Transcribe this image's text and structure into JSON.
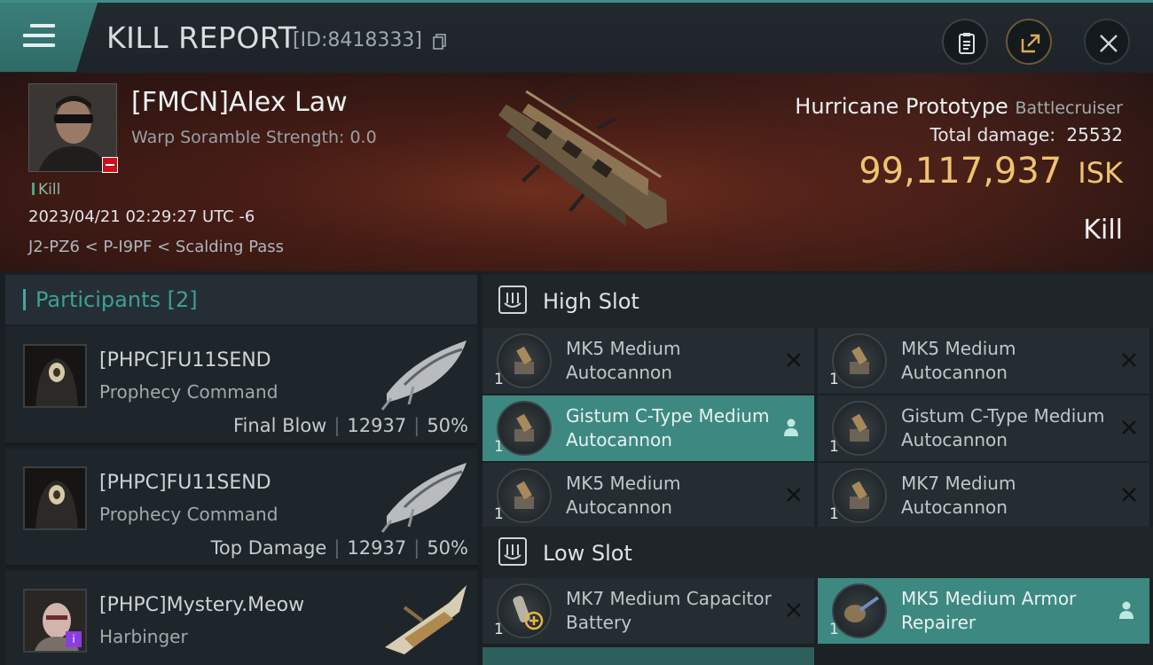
{
  "header": {
    "title": "KILL REPORT",
    "report_id": "[ID:8418333]",
    "icons": [
      "menu-icon",
      "copy-icon",
      "clipboard-icon",
      "share-icon",
      "close-icon"
    ]
  },
  "victim": {
    "name": "[FMCN]Alex Law",
    "scramble": "Warp Soramble Strength: 0.0",
    "kill_tag": "Kill",
    "datetime": "2023/04/21 02:29:27 UTC -6",
    "location": "J2-PZ6 < P-I9PF < Scalding Pass",
    "ship_name": "Hurricane Prototype",
    "ship_class": "Battlecruiser",
    "total_damage_label": "Total damage:",
    "total_damage": "25532",
    "isk_value": "99,117,937",
    "isk_unit": "ISK",
    "result": "Kill"
  },
  "participants": {
    "title": "Participants [2]",
    "rows": [
      {
        "name": "[PHPC]FU11SEND",
        "ship": "Prophecy Command",
        "role": "Final Blow",
        "damage": "12937",
        "percent": "50%"
      },
      {
        "name": "[PHPC]FU11SEND",
        "ship": "Prophecy Command",
        "role": "Top Damage",
        "damage": "12937",
        "percent": "50%"
      },
      {
        "name": "[PHPC]Mystery.Meow",
        "ship": "Harbinger",
        "badge": "i"
      }
    ]
  },
  "slots": {
    "high_title": "High Slot",
    "low_title": "Low Slot",
    "high": [
      {
        "qty": "1",
        "name": "MK5 Medium Autocannon",
        "highlight": false
      },
      {
        "qty": "1",
        "name": "MK5 Medium Autocannon",
        "highlight": false
      },
      {
        "qty": "1",
        "name": "Gistum C-Type Medium Autocannon",
        "highlight": true
      },
      {
        "qty": "1",
        "name": "Gistum C-Type Medium Autocannon",
        "highlight": false
      },
      {
        "qty": "1",
        "name": "MK5 Medium Autocannon",
        "highlight": false
      },
      {
        "qty": "1",
        "name": "MK7 Medium Autocannon",
        "highlight": false
      }
    ],
    "low": [
      {
        "qty": "1",
        "name": "MK7 Medium Capacitor Battery",
        "highlight": false
      },
      {
        "qty": "1",
        "name": "MK5 Medium Armor Repairer",
        "highlight": true
      }
    ]
  },
  "colors": {
    "accent": "#3f8e86",
    "isk": "#f0c46e",
    "highlight_row": "#3d8982"
  }
}
